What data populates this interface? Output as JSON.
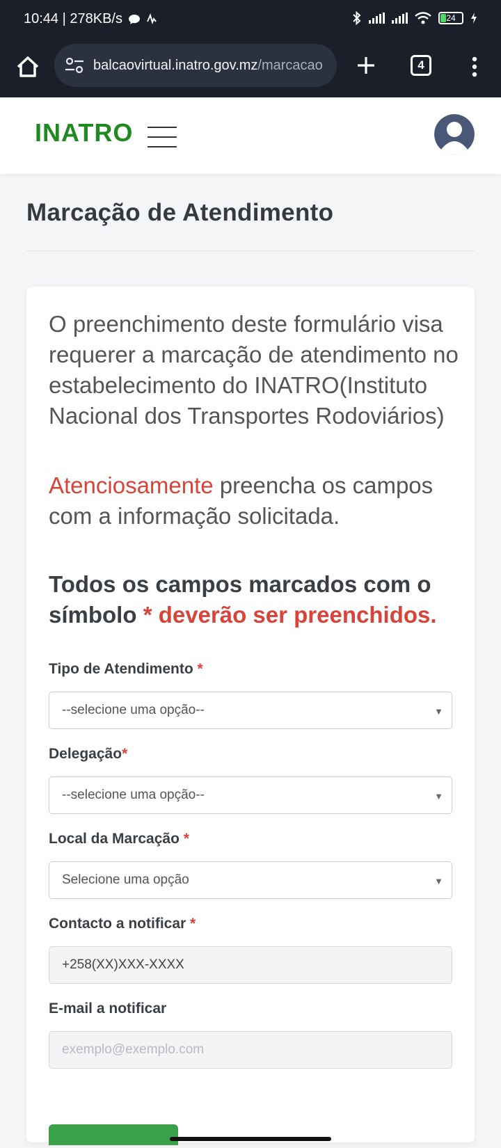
{
  "status_bar": {
    "time_speed": "10:44 | 278KB/s",
    "battery": "24"
  },
  "browser": {
    "url_host": "balcaovirtual.inatro.gov.mz",
    "url_path": "/marcacao",
    "tab_count": "4"
  },
  "site": {
    "logo": "INATRO"
  },
  "page": {
    "title": "Marcação de Atendimento",
    "intro": "O preenchimento deste formulário visa requerer a marcação de atendimento no estabelecimento do INATRO(Instituto Nacional dos Transportes Rodoviários)",
    "notice_emph": "Atenciosamente",
    "notice_rest": " preencha os campos com a informação solicitada.",
    "required_lead": "Todos os campos marcados com o símbolo ",
    "required_tail": "* deverão ser preenchidos."
  },
  "form": {
    "tipo_label": "Tipo de Atendimento",
    "tipo_value": "--selecione uma opção--",
    "delegacao_label": "Delegação",
    "delegacao_value": "--selecione uma opção--",
    "local_label": "Local da Marcação",
    "local_value": "Selecione uma opção",
    "contacto_label": "Contacto a notificar",
    "contacto_value": "+258(XX)XXX-XXXX",
    "email_label": "E-mail a notificar",
    "email_placeholder": "exemplo@exemplo.com",
    "required_star": "*"
  },
  "colors": {
    "brand_green": "#1f8a1f",
    "accent_red": "#d9443a",
    "button_green": "#3aa14a"
  }
}
